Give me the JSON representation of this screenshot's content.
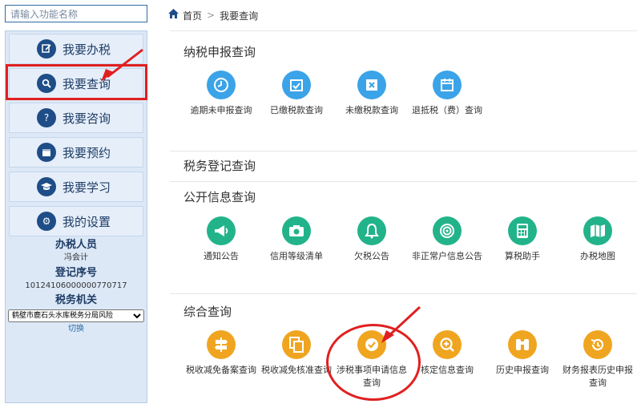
{
  "search": {
    "placeholder": "请输入功能名称"
  },
  "sidebar": {
    "items": [
      {
        "label": "我要办税",
        "icon": "edit-icon"
      },
      {
        "label": "我要查询",
        "icon": "search-icon"
      },
      {
        "label": "我要咨询",
        "icon": "question-icon"
      },
      {
        "label": "我要预约",
        "icon": "calendar-icon"
      },
      {
        "label": "我要学习",
        "icon": "graduation-cap-icon"
      },
      {
        "label": "我的设置",
        "icon": "gear-icon"
      }
    ],
    "user": {
      "role_title": "办税人员",
      "role_value": "冯会计",
      "reg_title": "登记序号",
      "reg_value": "10124106000000770717",
      "office_title": "税务机关",
      "office_value": "鹤壁市鹿石头水库税务分局风险",
      "switch_label": "切换"
    }
  },
  "breadcrumb": {
    "home": "首页",
    "separator": ">",
    "current": "我要查询"
  },
  "sections": {
    "declare": {
      "title": "纳税申报查询",
      "tiles": [
        {
          "label": "逾期未申报查询",
          "icon": "clock-icon"
        },
        {
          "label": "已缴税款查询",
          "icon": "calendar-check-icon"
        },
        {
          "label": "未缴税款查询",
          "icon": "close-box-icon"
        },
        {
          "label": "退抵税（费）查询",
          "icon": "calendar-icon"
        }
      ]
    },
    "register": {
      "title": "税务登记查询"
    },
    "public": {
      "title": "公开信息查询",
      "tiles": [
        {
          "label": "通知公告",
          "icon": "megaphone-icon"
        },
        {
          "label": "信用等级清单",
          "icon": "camera-icon"
        },
        {
          "label": "欠税公告",
          "icon": "bell-icon"
        },
        {
          "label": "非正常户信息公告",
          "icon": "target-icon"
        },
        {
          "label": "算税助手",
          "icon": "calculator-icon"
        },
        {
          "label": "办税地图",
          "icon": "map-icon"
        }
      ]
    },
    "general": {
      "title": "综合查询",
      "tiles": [
        {
          "label": "税收减免备案查询",
          "icon": "signpost-icon"
        },
        {
          "label": "税收减免核准查询",
          "icon": "copy-icon"
        },
        {
          "label": "涉税事项申请信息查询",
          "icon": "check-circle-icon"
        },
        {
          "label": "核定信息查询",
          "icon": "zoom-in-icon"
        },
        {
          "label": "历史申报查询",
          "icon": "binoculars-icon"
        },
        {
          "label": "财务报表历史申报查询",
          "icon": "history-icon"
        }
      ]
    }
  },
  "colors": {
    "accent_blue": "#3ba3e8",
    "accent_green": "#22b38a",
    "accent_orange": "#f0a520",
    "nav_dark": "#1e4d87",
    "annotation_red": "#e02020"
  }
}
